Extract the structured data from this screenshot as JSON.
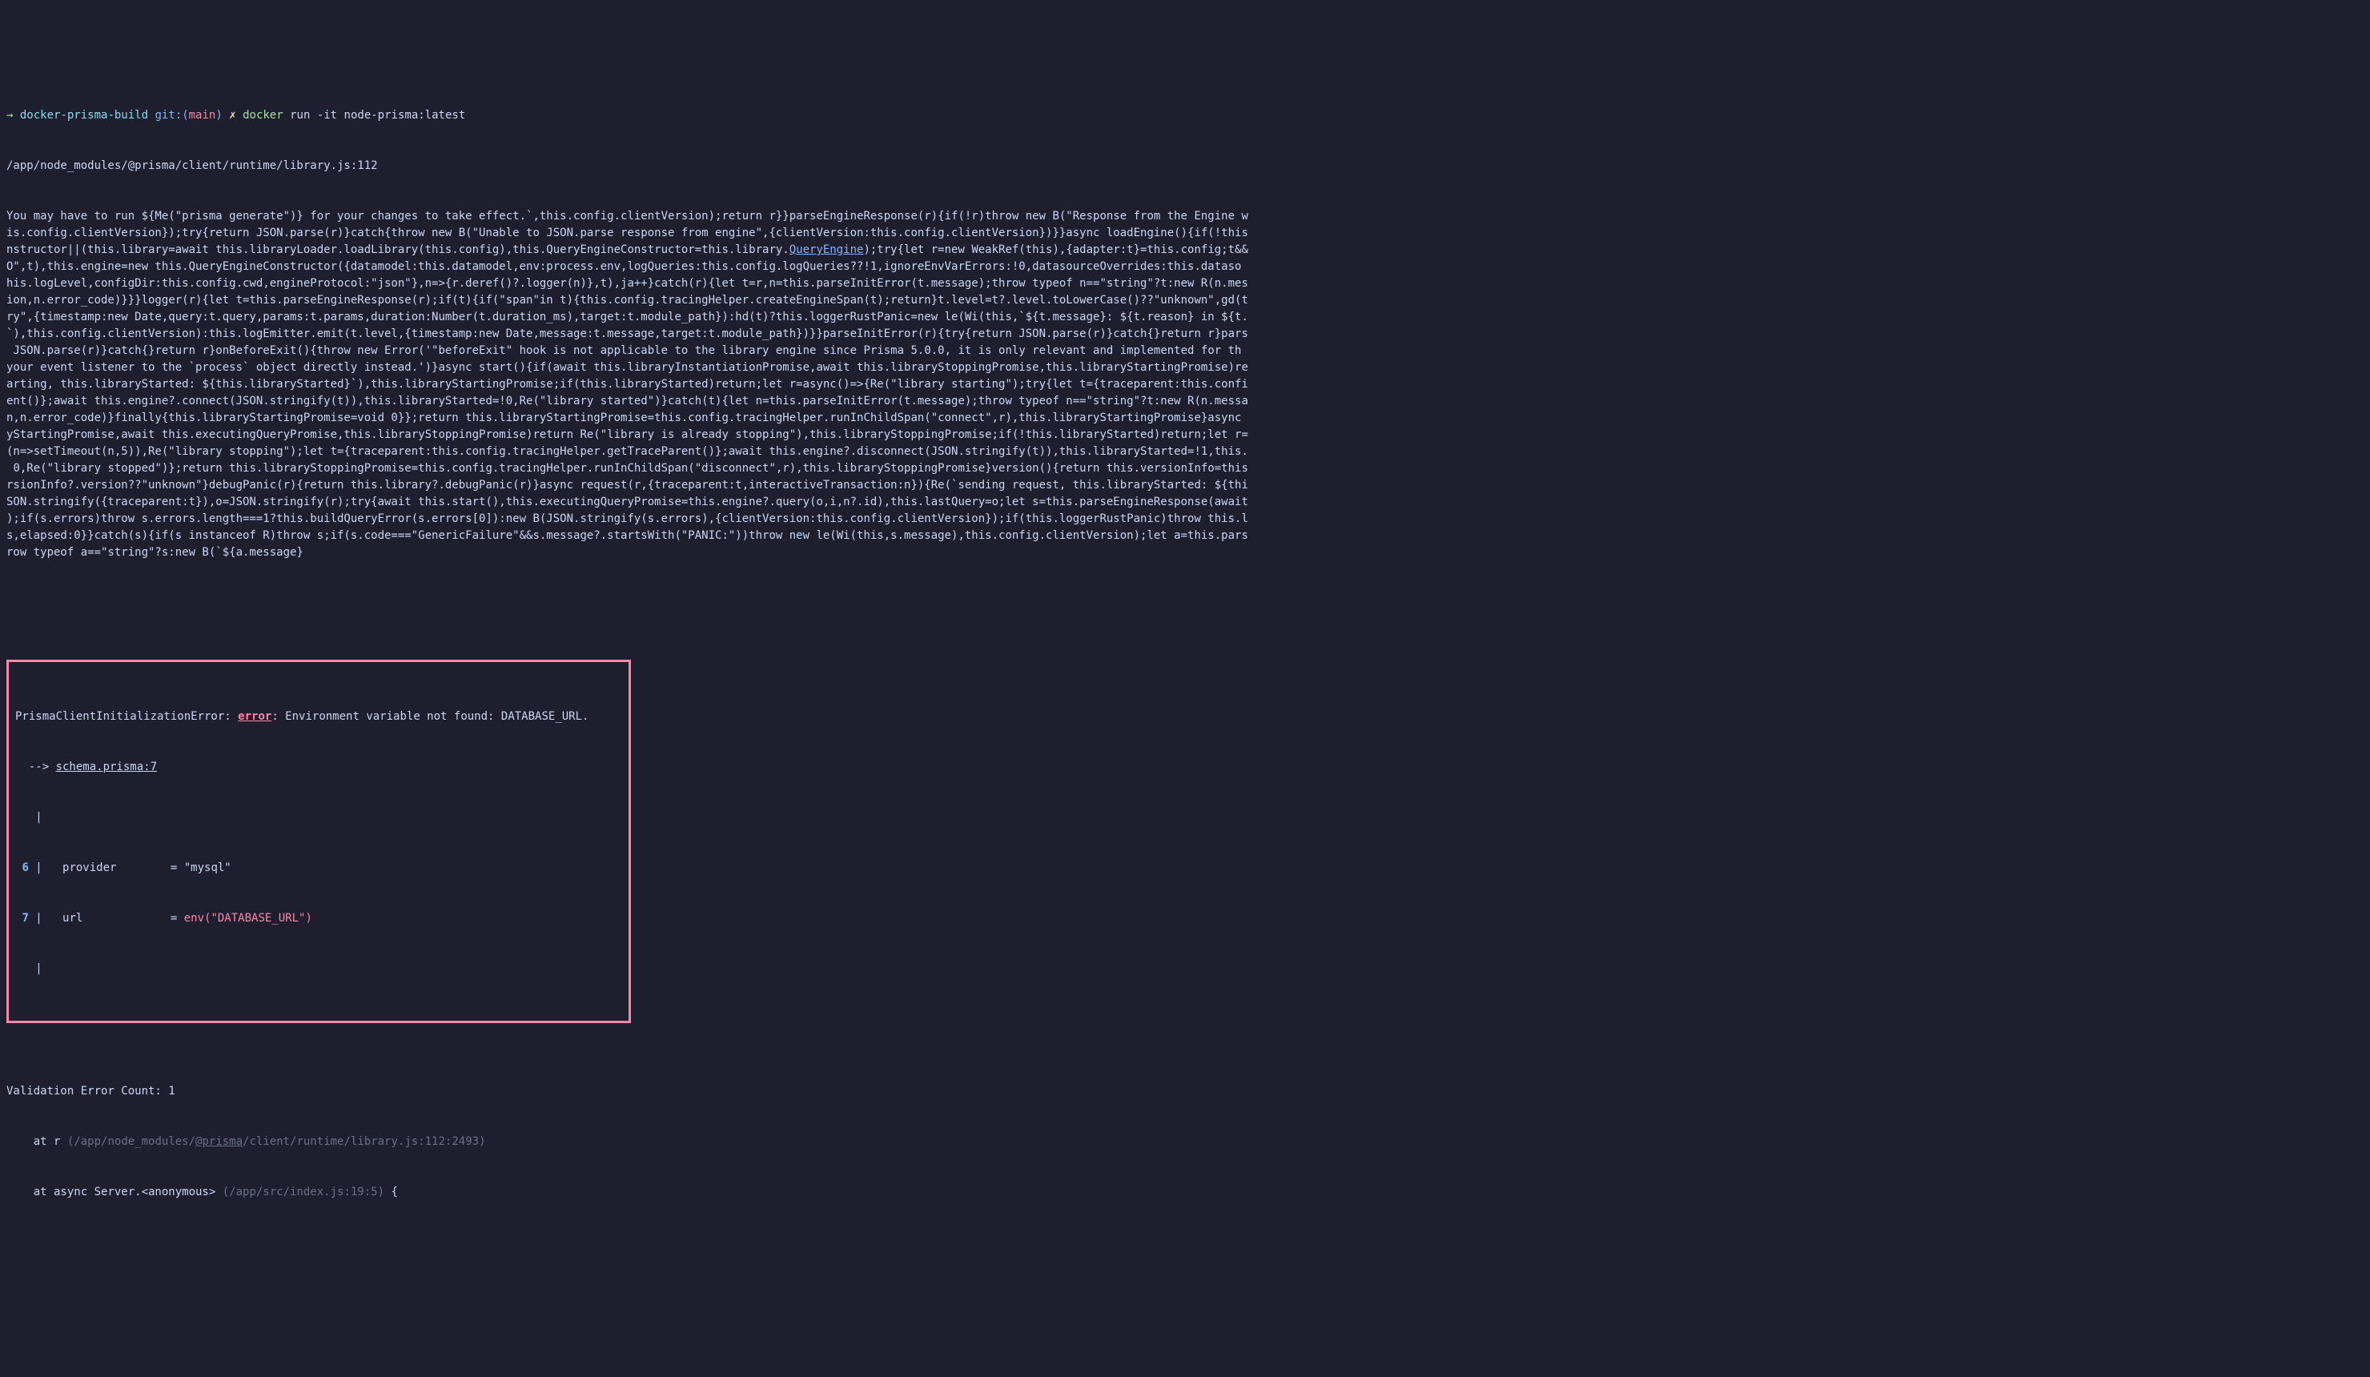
{
  "prompt": {
    "arrow": "→",
    "dir": "docker-prisma-build",
    "git": "git:",
    "paren_open": "(",
    "branch": "main",
    "paren_close": ")",
    "x": "✗",
    "command": "docker",
    "args": "run -it node-prisma:latest"
  },
  "output": {
    "path": "/app/node_modules/@prisma/client/runtime/library.js:112",
    "dump_pre": "You may have to run ${Me(\"prisma generate\")} for your changes to take effect.`,this.config.clientVersion);return r}}parseEngineResponse(r){if(!r)throw new B(\"Response from the Engine w\nis.config.clientVersion});try{return JSON.parse(r)}catch{throw new B(\"Unable to JSON.parse response from engine\",{clientVersion:this.config.clientVersion})}}async loadEngine(){if(!this\nnstructor||(this.library=await this.libraryLoader.loadLibrary(this.config),this.QueryEngineConstructor=this.library.",
    "query_engine": "QueryEngine",
    "dump_post": ");try{let r=new WeakRef(this),{adapter:t}=this.config;t&&\nO\",t),this.engine=new this.QueryEngineConstructor({datamodel:this.datamodel,env:process.env,logQueries:this.config.logQueries??!1,ignoreEnvVarErrors:!0,datasourceOverrides:this.dataso\nhis.logLevel,configDir:this.config.cwd,engineProtocol:\"json\"},n=>{r.deref()?.logger(n)},t),ja++}catch(r){let t=r,n=this.parseInitError(t.message);throw typeof n==\"string\"?t:new R(n.mes\nion,n.error_code)}}}logger(r){let t=this.parseEngineResponse(r);if(t){if(\"span\"in t){this.config.tracingHelper.createEngineSpan(t);return}t.level=t?.level.toLowerCase()??\"unknown\",gd(t\nry\",{timestamp:new Date,query:t.query,params:t.params,duration:Number(t.duration_ms),target:t.module_path}):hd(t)?this.loggerRustPanic=new le(Wi(this,`${t.message}: ${t.reason} in ${t.\n`),this.config.clientVersion):this.logEmitter.emit(t.level,{timestamp:new Date,message:t.message,target:t.module_path})}}parseInitError(r){try{return JSON.parse(r)}catch{}return r}pars\n JSON.parse(r)}catch{}return r}onBeforeExit(){throw new Error('\"beforeExit\" hook is not applicable to the library engine since Prisma 5.0.0, it is only relevant and implemented for th\nyour event listener to the `process` object directly instead.')}async start(){if(await this.libraryInstantiationPromise,await this.libraryStoppingPromise,this.libraryStartingPromise)re\narting, this.libraryStarted: ${this.libraryStarted}`),this.libraryStartingPromise;if(this.libraryStarted)return;let r=async()=>{Re(\"library starting\");try{let t={traceparent:this.confi\nent()};await this.engine?.connect(JSON.stringify(t)),this.libraryStarted=!0,Re(\"library started\")}catch(t){let n=this.parseInitError(t.message);throw typeof n==\"string\"?t:new R(n.messa\nn,n.error_code)}finally{this.libraryStartingPromise=void 0}};return this.libraryStartingPromise=this.config.tracingHelper.runInChildSpan(\"connect\",r),this.libraryStartingPromise}async\nyStartingPromise,await this.executingQueryPromise,this.libraryStoppingPromise)return Re(\"library is already stopping\"),this.libraryStoppingPromise;if(!this.libraryStarted)return;let r=\n(n=>setTimeout(n,5)),Re(\"library stopping\");let t={traceparent:this.config.tracingHelper.getTraceParent()};await this.engine?.disconnect(JSON.stringify(t)),this.libraryStarted=!1,this.\n 0,Re(\"library stopped\")};return this.libraryStoppingPromise=this.config.tracingHelper.runInChildSpan(\"disconnect\",r),this.libraryStoppingPromise}version(){return this.versionInfo=this\nrsionInfo?.version??\"unknown\"}debugPanic(r){return this.library?.debugPanic(r)}async request(r,{traceparent:t,interactiveTransaction:n}){Re(`sending request, this.libraryStarted: ${thi\nSON.stringify({traceparent:t}),o=JSON.stringify(r);try{await this.start(),this.executingQueryPromise=this.engine?.query(o,i,n?.id),this.lastQuery=o;let s=this.parseEngineResponse(await\n);if(s.errors)throw s.errors.length===1?this.buildQueryError(s.errors[0]):new B(JSON.stringify(s.errors),{clientVersion:this.config.clientVersion});if(this.loggerRustPanic)throw this.l\ns,elapsed:0}}catch(s){if(s instanceof R)throw s;if(s.code===\"GenericFailure\"&&s.message?.startsWith(\"PANIC:\"))throw new le(Wi(this,s.message),this.config.clientVersion);let a=this.pars\nrow typeof a==\"string\"?s:new B(`${a.message}"
  },
  "error": {
    "title": "PrismaClientInitializationError: ",
    "error_word": "error",
    "message": ": Environment variable not found: DATABASE_URL.",
    "arrow": "  --> ",
    "schema_ref": "schema.prisma:7",
    "pipe_empty": "   | ",
    "line6_num": " 6 ",
    "line6_pipe": "| ",
    "line6_content": "  provider        = \"mysql\"",
    "line7_num": " 7 ",
    "line7_pipe": "| ",
    "line7_content_pre": "  url             = ",
    "line7_env": "env(\"DATABASE_URL\")"
  },
  "footer": {
    "validation": "Validation Error Count: 1",
    "at1_pre": "    at r ",
    "at1_paren_open": "(",
    "at1_path_pre": "/app/node_modules/",
    "at1_prisma": "@prisma",
    "at1_path_post": "/client/runtime/library.js:112:2493",
    "at1_paren_close": ")",
    "at2_pre": "    at async Server.<anonymous> ",
    "at2_path": "(/app/src/index.js:19:5)",
    "at2_brace": " {"
  }
}
